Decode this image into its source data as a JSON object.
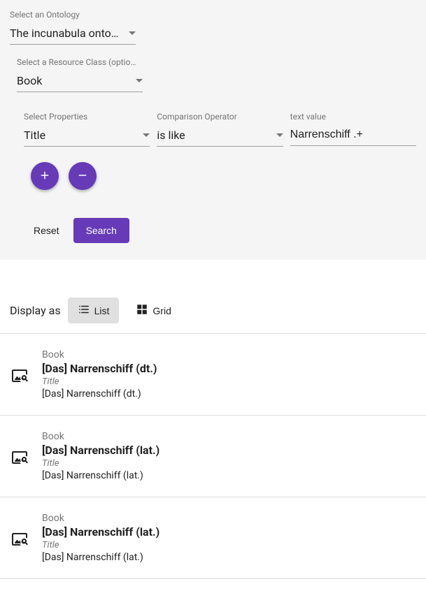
{
  "search": {
    "ontology_label": "Select an Ontology",
    "ontology_value": "The incunabula onto…",
    "resource_label": "Select a Resource Class (optio…",
    "resource_value": "Book",
    "criteria": {
      "property_label": "Select Properties",
      "property_value": "Title",
      "operator_label": "Comparison Operator",
      "operator_value": "is like",
      "text_label": "text value",
      "text_value": "Narrenschiff .+"
    },
    "reset_label": "Reset",
    "search_label": "Search"
  },
  "display": {
    "label": "Display as",
    "list_label": "List",
    "grid_label": "Grid"
  },
  "results": [
    {
      "type": "Book",
      "title": "[Das] Narrenschiff (dt.)",
      "prop_label": "Title",
      "prop_value": "[Das] Narrenschiff (dt.)"
    },
    {
      "type": "Book",
      "title": "[Das] Narrenschiff (lat.)",
      "prop_label": "Title",
      "prop_value": "[Das] Narrenschiff (lat.)"
    },
    {
      "type": "Book",
      "title": "[Das] Narrenschiff (lat.)",
      "prop_label": "Title",
      "prop_value": "[Das] Narrenschiff (lat.)"
    }
  ]
}
